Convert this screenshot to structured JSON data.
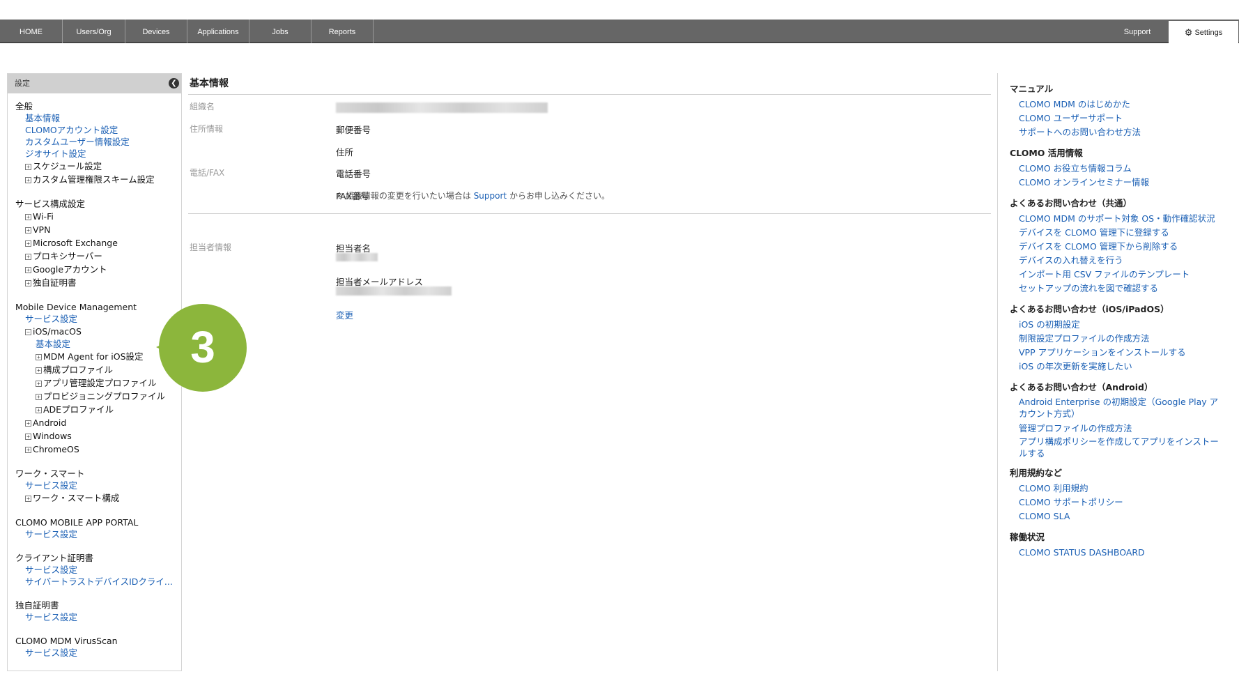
{
  "nav": {
    "items": [
      {
        "label": "HOME"
      },
      {
        "label": "Users/Org"
      },
      {
        "label": "Devices"
      },
      {
        "label": "Applications"
      },
      {
        "label": "Jobs"
      },
      {
        "label": "Reports"
      }
    ],
    "support_label": "Support",
    "settings_label": "Settings"
  },
  "sidebar": {
    "header": "設定",
    "general": {
      "title": "全般",
      "links": [
        "基本情報",
        "CLOMOアカウント設定",
        "カスタムユーザー情報設定",
        "ジオサイト設定"
      ],
      "expandables": [
        "スケジュール設定",
        "カスタム管理権限スキーム設定"
      ]
    },
    "service_config": {
      "title": "サービス構成設定",
      "expandables": [
        "Wi-Fi",
        "VPN",
        "Microsoft Exchange",
        "プロキシサーバー",
        "Googleアカウント",
        "独自証明書"
      ]
    },
    "mdm": {
      "title": "Mobile Device Management",
      "service_link": "サービス設定",
      "ios": "iOS/macOS",
      "ios_basic": "基本設定",
      "ios_children": [
        "MDM Agent for iOS設定",
        "構成プロファイル",
        "アプリ管理設定プロファイル",
        "プロビジョニングプロファイル",
        "ADEプロファイル"
      ],
      "platforms": [
        "Android",
        "Windows",
        "ChromeOS"
      ]
    },
    "work_smart": {
      "title": "ワーク・スマート",
      "service_link": "サービス設定",
      "expandable": "ワーク・スマート構成"
    },
    "app_portal": {
      "title": "CLOMO MOBILE APP PORTAL",
      "service_link": "サービス設定"
    },
    "client_cert": {
      "title": "クライアント証明書",
      "service_link": "サービス設定",
      "cyber_link": "サイバートラストデバイスIDクライ..."
    },
    "own_cert": {
      "title": "独自証明書",
      "service_link": "サービス設定"
    },
    "virusscan": {
      "title": "CLOMO MDM VirusScan",
      "service_link": "サービス設定"
    }
  },
  "callout": {
    "number": "3",
    "color": "#8cb63c"
  },
  "main": {
    "title": "基本情報",
    "org_label": "組織名",
    "address_label": "住所情報",
    "postal_label": "郵便番号",
    "address_field_label": "住所",
    "phone_section_label": "電話/FAX",
    "phone_label": "電話番号",
    "fax_label": "FAX番号",
    "note_prefix": "※ 組織情報の変更を行いたい場合は ",
    "note_link": "Support",
    "note_suffix": " からお申し込みください。",
    "contact_section_label": "担当者情報",
    "contact_name_label": "担当者名",
    "contact_email_label": "担当者メールアドレス",
    "change_link": "変更"
  },
  "right_panel": {
    "groups": [
      {
        "heading": "マニュアル",
        "links": [
          "CLOMO MDM のはじめかた",
          "CLOMO ユーザーサポート",
          "サポートへのお問い合わせ方法"
        ]
      },
      {
        "heading": "CLOMO 活用情報",
        "links": [
          "CLOMO お役立ち情報コラム",
          "CLOMO オンラインセミナー情報"
        ]
      },
      {
        "heading": "よくあるお問い合わせ（共通）",
        "links": [
          "CLOMO MDM のサポート対象 OS・動作確認状況",
          "デバイスを CLOMO 管理下に登録する",
          "デバイスを CLOMO 管理下から削除する",
          "デバイスの入れ替えを行う",
          "インポート用 CSV ファイルのテンプレート",
          "セットアップの流れを図で確認する"
        ]
      },
      {
        "heading": "よくあるお問い合わせ（iOS/iPadOS）",
        "links": [
          "iOS の初期設定",
          "制限設定プロファイルの作成方法",
          "VPP アプリケーションをインストールする",
          "iOS の年次更新を実施したい"
        ]
      },
      {
        "heading": "よくあるお問い合わせ（Android）",
        "links": [
          "Android Enterprise の初期設定（Google Play アカウント方式）",
          "管理プロファイルの作成方法",
          "アプリ構成ポリシーを作成してアプリをインストールする"
        ]
      },
      {
        "heading": "利用規約など",
        "links": [
          "CLOMO 利用規約",
          "CLOMO サポートポリシー",
          "CLOMO SLA"
        ]
      },
      {
        "heading": "稼働状況",
        "links": [
          "CLOMO STATUS DASHBOARD"
        ]
      }
    ]
  }
}
